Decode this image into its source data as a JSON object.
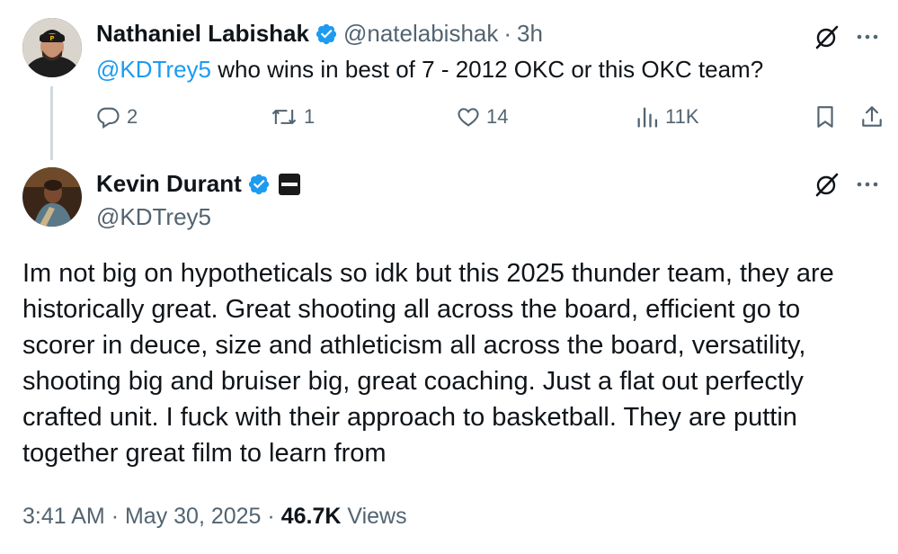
{
  "reply_tweet": {
    "author_name": "Nathaniel Labishak",
    "author_handle": "@natelabishak",
    "separator": "·",
    "time_ago": "3h",
    "mention": "@KDTrey5",
    "text": " who wins in best of 7 - 2012 OKC or this OKC team?",
    "actions": {
      "replies": "2",
      "reposts": "1",
      "likes": "14",
      "views": "11K"
    }
  },
  "main_tweet": {
    "author_name": "Kevin Durant",
    "author_handle": "@KDTrey5",
    "text": "Im not big on hypotheticals so idk but this 2025 thunder team, they are historically great. Great shooting all across the board, efficient go to scorer in deuce, size and athleticism all across the board, versatility, shooting big and bruiser big, great coaching. Just a flat out perfectly crafted unit. I fuck with their approach to basketball. They are puttin together great film to learn from",
    "time": "3:41 AM",
    "separator": "·",
    "date": "May 30, 2025",
    "views_count": "46.7K",
    "views_label": "Views"
  },
  "colors": {
    "accent": "#1d9bf0",
    "text_primary": "#0f1419",
    "text_secondary": "#536471",
    "thread_line": "#cfd9de"
  },
  "icons": [
    "grok-icon",
    "more-icon",
    "verified-badge-icon",
    "reply-icon",
    "repost-icon",
    "like-icon",
    "views-icon",
    "bookmark-icon",
    "share-icon",
    "affiliate-badge-icon"
  ]
}
